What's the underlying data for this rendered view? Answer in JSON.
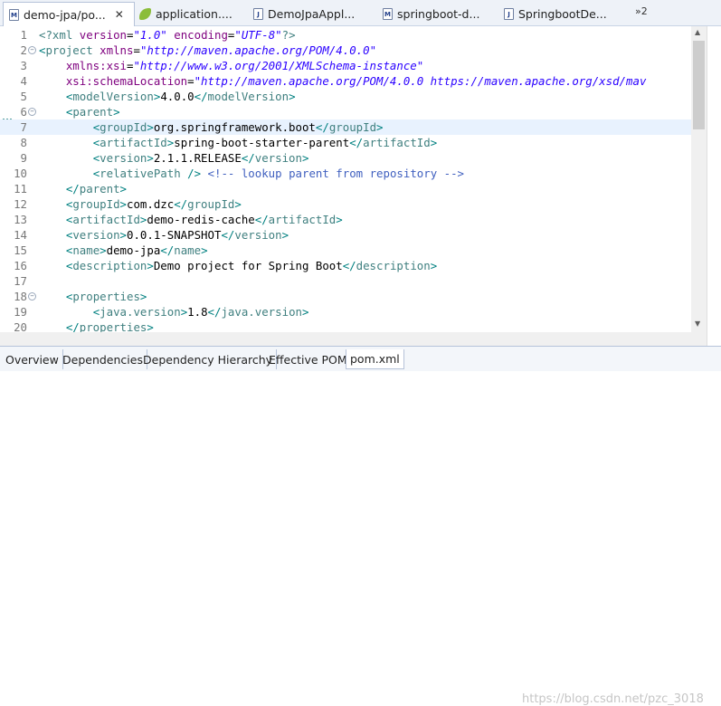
{
  "tabs": [
    {
      "label": "demo-jpa/po...",
      "icon": "maven-pom-icon",
      "active": true,
      "closable": true
    },
    {
      "label": "application....",
      "icon": "spring-leaf-icon",
      "active": false
    },
    {
      "label": "DemoJpaAppl...",
      "icon": "java-file-icon",
      "active": false
    },
    {
      "label": "springboot-d...",
      "icon": "maven-pom-icon",
      "active": false
    },
    {
      "label": "SpringbootDe...",
      "icon": "java-file-icon",
      "active": false
    }
  ],
  "overflow_label": "»2",
  "editor": {
    "current_line": 7,
    "lines": [
      {
        "n": "1",
        "fold": false,
        "segs": [
          [
            "pi",
            "<?xml "
          ],
          [
            "at",
            "version"
          ],
          [
            "tx",
            "="
          ],
          [
            "av",
            "\"1.0\""
          ],
          [
            "tx",
            " "
          ],
          [
            "at",
            "encoding"
          ],
          [
            "tx",
            "="
          ],
          [
            "av",
            "\"UTF-8\""
          ],
          [
            "pi",
            "?>"
          ]
        ]
      },
      {
        "n": "2",
        "fold": true,
        "segs": [
          [
            "br",
            "<"
          ],
          [
            "tg",
            "project"
          ],
          [
            "tx",
            " "
          ],
          [
            "at",
            "xmlns"
          ],
          [
            "tx",
            "="
          ],
          [
            "av",
            "\"http://maven.apache.org/POM/4.0.0\""
          ]
        ]
      },
      {
        "n": "3",
        "fold": false,
        "segs": [
          [
            "tx",
            "    "
          ],
          [
            "at",
            "xmlns:xsi"
          ],
          [
            "tx",
            "="
          ],
          [
            "av",
            "\"http://www.w3.org/2001/XMLSchema-instance\""
          ]
        ]
      },
      {
        "n": "4",
        "fold": false,
        "segs": [
          [
            "tx",
            "    "
          ],
          [
            "at",
            "xsi:schemaLocation"
          ],
          [
            "tx",
            "="
          ],
          [
            "av",
            "\"http://maven.apache.org/POM/4.0.0 https://maven.apache.org/xsd/mav"
          ]
        ]
      },
      {
        "n": "5",
        "fold": false,
        "segs": [
          [
            "tx",
            "    "
          ],
          [
            "br",
            "<"
          ],
          [
            "tg",
            "modelVersion"
          ],
          [
            "br",
            ">"
          ],
          [
            "tx",
            "4.0.0"
          ],
          [
            "br",
            "</"
          ],
          [
            "tg",
            "modelVersion"
          ],
          [
            "br",
            ">"
          ]
        ]
      },
      {
        "n": "6",
        "fold": true,
        "segs": [
          [
            "tx",
            "    "
          ],
          [
            "br",
            "<"
          ],
          [
            "tg",
            "parent"
          ],
          [
            "br",
            ">"
          ]
        ]
      },
      {
        "n": "7",
        "fold": false,
        "segs": [
          [
            "tx",
            "        "
          ],
          [
            "br",
            "<"
          ],
          [
            "tg",
            "groupId"
          ],
          [
            "br",
            ">"
          ],
          [
            "tx",
            "org.springframework.boot"
          ],
          [
            "br",
            "</"
          ],
          [
            "tg",
            "groupId"
          ],
          [
            "br",
            ">"
          ]
        ]
      },
      {
        "n": "8",
        "fold": false,
        "segs": [
          [
            "tx",
            "        "
          ],
          [
            "br",
            "<"
          ],
          [
            "tg",
            "artifactId"
          ],
          [
            "br",
            ">"
          ],
          [
            "tx",
            "spring-boot-starter-parent"
          ],
          [
            "br",
            "</"
          ],
          [
            "tg",
            "artifactId"
          ],
          [
            "br",
            ">"
          ]
        ]
      },
      {
        "n": "9",
        "fold": false,
        "segs": [
          [
            "tx",
            "        "
          ],
          [
            "br",
            "<"
          ],
          [
            "tg",
            "version"
          ],
          [
            "br",
            ">"
          ],
          [
            "tx",
            "2.1.1.RELEASE"
          ],
          [
            "br",
            "</"
          ],
          [
            "tg",
            "version"
          ],
          [
            "br",
            ">"
          ]
        ]
      },
      {
        "n": "10",
        "fold": false,
        "segs": [
          [
            "tx",
            "        "
          ],
          [
            "br",
            "<"
          ],
          [
            "tg",
            "relativePath"
          ],
          [
            "tx",
            " "
          ],
          [
            "br",
            "/>"
          ],
          [
            "tx",
            " "
          ],
          [
            "cm",
            "<!-- lookup parent from repository -->"
          ]
        ]
      },
      {
        "n": "11",
        "fold": false,
        "segs": [
          [
            "tx",
            "    "
          ],
          [
            "br",
            "</"
          ],
          [
            "tg",
            "parent"
          ],
          [
            "br",
            ">"
          ]
        ]
      },
      {
        "n": "12",
        "fold": false,
        "segs": [
          [
            "tx",
            "    "
          ],
          [
            "br",
            "<"
          ],
          [
            "tg",
            "groupId"
          ],
          [
            "br",
            ">"
          ],
          [
            "tx",
            "com.dzc"
          ],
          [
            "br",
            "</"
          ],
          [
            "tg",
            "groupId"
          ],
          [
            "br",
            ">"
          ]
        ]
      },
      {
        "n": "13",
        "fold": false,
        "segs": [
          [
            "tx",
            "    "
          ],
          [
            "br",
            "<"
          ],
          [
            "tg",
            "artifactId"
          ],
          [
            "br",
            ">"
          ],
          [
            "tx",
            "demo-redis-cache"
          ],
          [
            "br",
            "</"
          ],
          [
            "tg",
            "artifactId"
          ],
          [
            "br",
            ">"
          ]
        ]
      },
      {
        "n": "14",
        "fold": false,
        "segs": [
          [
            "tx",
            "    "
          ],
          [
            "br",
            "<"
          ],
          [
            "tg",
            "version"
          ],
          [
            "br",
            ">"
          ],
          [
            "tx",
            "0.0.1-SNAPSHOT"
          ],
          [
            "br",
            "</"
          ],
          [
            "tg",
            "version"
          ],
          [
            "br",
            ">"
          ]
        ]
      },
      {
        "n": "15",
        "fold": false,
        "segs": [
          [
            "tx",
            "    "
          ],
          [
            "br",
            "<"
          ],
          [
            "tg",
            "name"
          ],
          [
            "br",
            ">"
          ],
          [
            "tx",
            "demo-jpa"
          ],
          [
            "br",
            "</"
          ],
          [
            "tg",
            "name"
          ],
          [
            "br",
            ">"
          ]
        ]
      },
      {
        "n": "16",
        "fold": false,
        "segs": [
          [
            "tx",
            "    "
          ],
          [
            "br",
            "<"
          ],
          [
            "tg",
            "description"
          ],
          [
            "br",
            ">"
          ],
          [
            "tx",
            "Demo project for Spring Boot"
          ],
          [
            "br",
            "</"
          ],
          [
            "tg",
            "description"
          ],
          [
            "br",
            ">"
          ]
        ]
      },
      {
        "n": "17",
        "fold": false,
        "segs": []
      },
      {
        "n": "18",
        "fold": true,
        "segs": [
          [
            "tx",
            "    "
          ],
          [
            "br",
            "<"
          ],
          [
            "tg",
            "properties"
          ],
          [
            "br",
            ">"
          ]
        ]
      },
      {
        "n": "19",
        "fold": false,
        "segs": [
          [
            "tx",
            "        "
          ],
          [
            "br",
            "<"
          ],
          [
            "tg",
            "java.version"
          ],
          [
            "br",
            ">"
          ],
          [
            "tx",
            "1.8"
          ],
          [
            "br",
            "</"
          ],
          [
            "tg",
            "java.version"
          ],
          [
            "br",
            ">"
          ]
        ]
      },
      {
        "n": "20",
        "fold": false,
        "segs": [
          [
            "tx",
            "    "
          ],
          [
            "br",
            "</"
          ],
          [
            "tg",
            "properties"
          ],
          [
            "br",
            ">"
          ]
        ]
      }
    ]
  },
  "bottom_tabs": [
    {
      "label": "Overview",
      "active": false
    },
    {
      "label": "Dependencies",
      "active": false
    },
    {
      "label": "Dependency Hierarchy",
      "active": false
    },
    {
      "label": "Effective POM",
      "active": false
    },
    {
      "label": "pom.xml",
      "active": true
    }
  ],
  "watermark": "https://blog.csdn.net/pzc_3018",
  "colors": {
    "tag": "#3f7f7f",
    "attribute": "#7f007f",
    "attr_value": "#2a00ff",
    "comment": "#3f5fbf",
    "current_line": "#e8f2fe"
  }
}
